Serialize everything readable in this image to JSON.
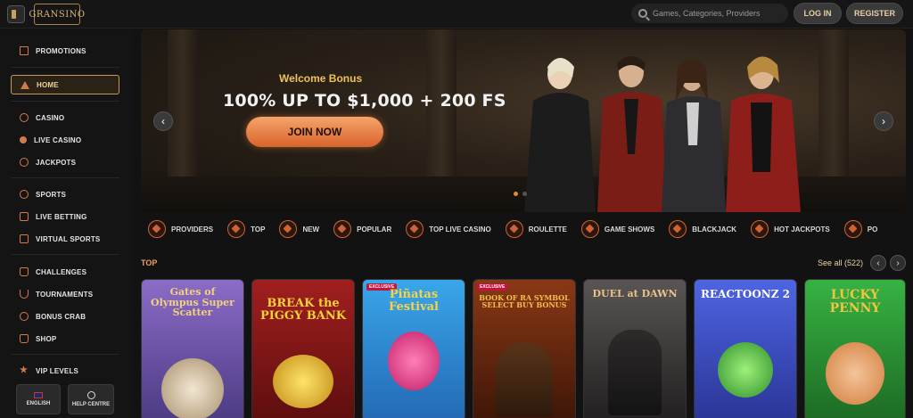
{
  "header": {
    "logo_text": "GRANSINO",
    "search_placeholder": "Games, Categories, Providers",
    "login_label": "LOG IN",
    "register_label": "REGISTER"
  },
  "sidebar": {
    "items": [
      {
        "label": "PROMOTIONS",
        "icon": "gift-icon"
      },
      {
        "label": "HOME",
        "icon": "home-icon",
        "active": true
      },
      {
        "label": "CASINO",
        "icon": "casino-icon"
      },
      {
        "label": "LIVE CASINO",
        "icon": "live-casino-icon"
      },
      {
        "label": "JACKPOTS",
        "icon": "jackpots-icon"
      },
      {
        "label": "SPORTS",
        "icon": "sports-icon"
      },
      {
        "label": "LIVE BETTING",
        "icon": "live-betting-icon"
      },
      {
        "label": "VIRTUAL SPORTS",
        "icon": "virtual-sports-icon"
      },
      {
        "label": "CHALLENGES",
        "icon": "challenges-icon"
      },
      {
        "label": "TOURNAMENTS",
        "icon": "trophy-icon"
      },
      {
        "label": "BONUS CRAB",
        "icon": "crab-icon"
      },
      {
        "label": "SHOP",
        "icon": "shop-icon"
      },
      {
        "label": "VIP LEVELS",
        "icon": "vip-icon"
      }
    ],
    "language_label": "ENGLISH",
    "help_label": "HELP CENTRE"
  },
  "banner": {
    "title": "Welcome Bonus",
    "offer": "100% UP TO $1,000 + 200 FS",
    "cta_label": "JOIN NOW",
    "prev_arrow": "‹",
    "next_arrow": "›"
  },
  "categories": [
    {
      "label": "PROVIDERS",
      "icon": "providers-icon"
    },
    {
      "label": "TOP",
      "icon": "top-icon"
    },
    {
      "label": "NEW",
      "icon": "new-icon"
    },
    {
      "label": "POPULAR",
      "icon": "popular-icon"
    },
    {
      "label": "TOP LIVE CASINO",
      "icon": "top-live-casino-icon"
    },
    {
      "label": "ROULETTE",
      "icon": "roulette-icon"
    },
    {
      "label": "GAME SHOWS",
      "icon": "game-shows-icon"
    },
    {
      "label": "BLACKJACK",
      "icon": "blackjack-icon"
    },
    {
      "label": "HOT JACKPOTS",
      "icon": "hot-jackpots-icon"
    },
    {
      "label": "PO",
      "icon": "more-icon"
    }
  ],
  "section": {
    "title": "TOP",
    "see_all_label": "See all (522)",
    "prev": "‹",
    "next": "›"
  },
  "games": [
    {
      "title": "Gates of Olympus Super Scatter",
      "bg": "#7a5fb0",
      "text_color": "#f3d27a"
    },
    {
      "title": "BREAK the PIGGY BANK",
      "bg": "#8a1a1a",
      "text_color": "#f6d23a"
    },
    {
      "title": "Piñatas Festival",
      "bg": "#2f8fd6",
      "text_color": "#f7d348",
      "badge": "EXCLUSIVE"
    },
    {
      "title": "BOOK OF RA SYMBOL SELECT BUY BONUS",
      "bg": "#6e2a12",
      "text_color": "#f0c14a",
      "badge": "EXCLUSIVE"
    },
    {
      "title": "DUEL at DAWN",
      "bg": "#3c3a3a",
      "text_color": "#e8c38a"
    },
    {
      "title": "REACTOONZ 2",
      "bg": "#3a4fd0",
      "text_color": "#ffffff"
    },
    {
      "title": "LUCKY PENNY",
      "bg": "#2f9e3a",
      "text_color": "#f2c53d"
    }
  ]
}
